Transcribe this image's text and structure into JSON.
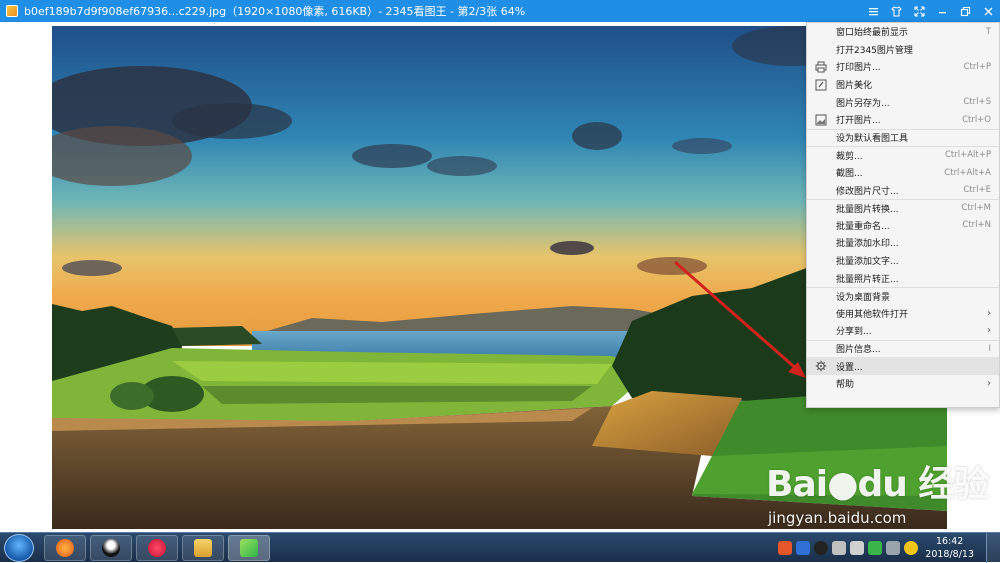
{
  "titlebar": {
    "title": "b0ef189b7d9f908ef67936...c229.jpg（1920×1080像素, 616KB）- 2345看图王 - 第2/3张 64%",
    "icons": [
      "app-icon",
      "menu-icon",
      "shirt-icon",
      "fullscreen-icon",
      "minimize-icon",
      "restore-icon",
      "close-icon"
    ]
  },
  "menu": {
    "items": [
      {
        "label": "窗口始终最前显示",
        "shortcut": "T"
      },
      {
        "label": "打开2345图片管理",
        "shortcut": ""
      },
      {
        "label": "打印图片...",
        "shortcut": "Ctrl+P",
        "icon": "printer-icon"
      },
      {
        "label": "图片美化",
        "shortcut": "",
        "icon": "edit-icon"
      },
      {
        "label": "图片另存为...",
        "shortcut": "Ctrl+S"
      },
      {
        "label": "打开图片...",
        "shortcut": "Ctrl+O",
        "icon": "image-icon"
      },
      {
        "label": "设为默认看图工具",
        "shortcut": ""
      },
      {
        "label": "裁剪...",
        "shortcut": "Ctrl+Alt+P"
      },
      {
        "label": "截图...",
        "shortcut": "Ctrl+Alt+A"
      },
      {
        "label": "修改图片尺寸...",
        "shortcut": "Ctrl+E"
      },
      {
        "label": "批量图片转换...",
        "shortcut": "Ctrl+M"
      },
      {
        "label": "批量重命名...",
        "shortcut": "Ctrl+N"
      },
      {
        "label": "批量添加水印...",
        "shortcut": ""
      },
      {
        "label": "批量添加文字...",
        "shortcut": ""
      },
      {
        "label": "批量照片转正...",
        "shortcut": ""
      },
      {
        "label": "设为桌面背景",
        "shortcut": ""
      },
      {
        "label": "使用其他软件打开",
        "shortcut": "",
        "submenu": true
      },
      {
        "label": "分享到...",
        "shortcut": "",
        "submenu": true
      },
      {
        "label": "图片信息...",
        "shortcut": "I"
      },
      {
        "label": "设置...",
        "shortcut": "",
        "icon": "gear-icon",
        "highlighted": true
      },
      {
        "label": "帮助",
        "shortcut": "",
        "submenu": true
      }
    ],
    "submenu_glyph": "›"
  },
  "watermark": {
    "logo": "Bai●du 经验",
    "url": "jingyan.baidu.com"
  },
  "taskbar": {
    "time": "16:42",
    "date": "2018/8/13",
    "apps": [
      "browser-app",
      "qq-app",
      "xiu-app",
      "explorer-app",
      "image-viewer-app"
    ]
  },
  "colors": {
    "titlebar": "#1f8ee6",
    "menu_bg": "#f5f5f5",
    "menu_highlight": "#e3e3e3",
    "arrow": "#d1231d"
  }
}
